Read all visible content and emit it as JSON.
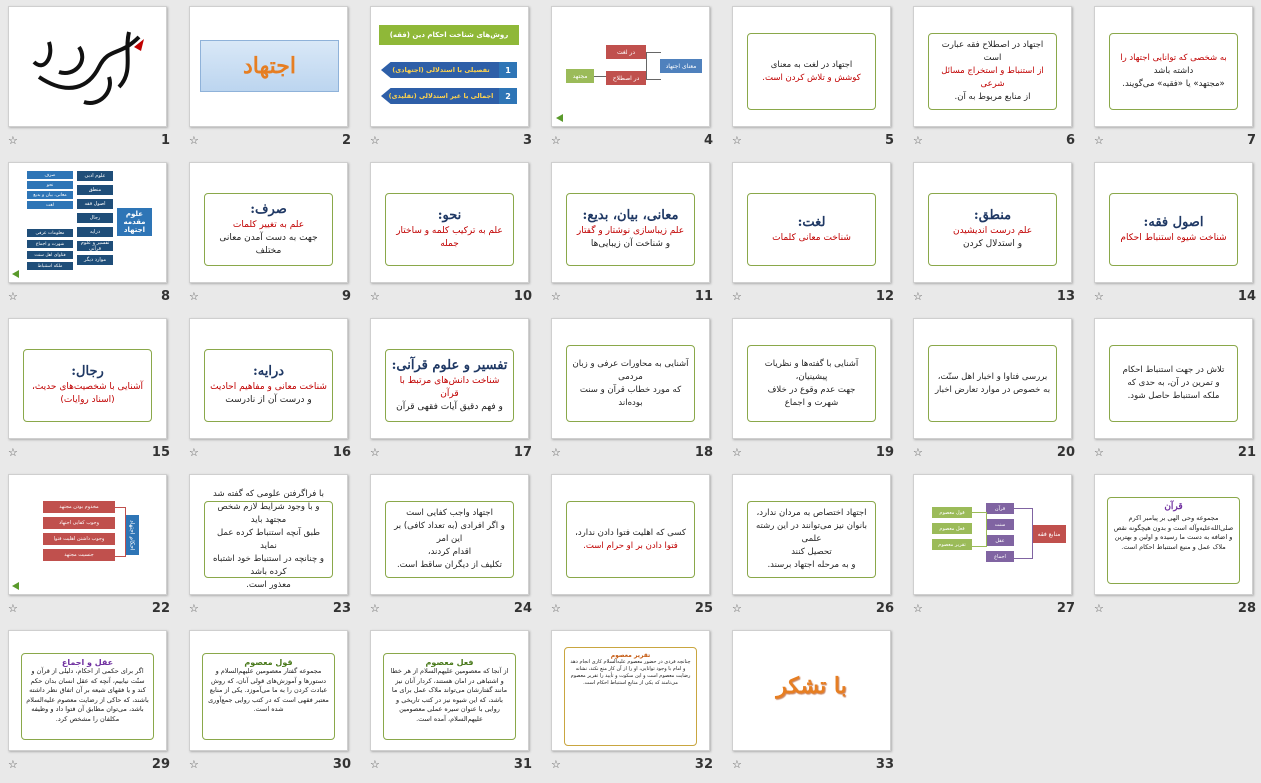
{
  "slides": [
    {
      "n": "1",
      "calligraphy": "بسم الله الرحمن الرحیم"
    },
    {
      "n": "2",
      "title": "اجتهاد"
    },
    {
      "n": "3",
      "header": "روش‌های شناخت احکام دین (فقه)",
      "item1": "تفصیلی با استدلالی (اجتهادی)",
      "item2": "اجمالی یا غیر استدلالی (تقلیدی)",
      "num1": "1",
      "num2": "2"
    },
    {
      "n": "4",
      "left": "معنای اجتهاد",
      "a": "در لغت",
      "b": "در اصطلاح",
      "c": "مجتهد"
    },
    {
      "n": "5",
      "line1": "اجتهاد در لغت به معنای",
      "line2": "کوشش و تلاش کردن است."
    },
    {
      "n": "6",
      "line1": "اجتهاد در اصطلاح فقه عبارت است",
      "line2": "از استنباط و استخراج مسائل شرعی",
      "line3": "از منابع مربوط به آن."
    },
    {
      "n": "7",
      "line1": "به شخصی که توانایی اجتهاد را",
      "line2": "داشته باشد",
      "line3": "«مجتهد» یا «فقیه» می‌گویند."
    },
    {
      "n": "8",
      "root": "علوم مقدمه اجتهاد",
      "items": [
        "علوم ادبی",
        "منطق",
        "اصول فقه",
        "رجال",
        "درایه",
        "تفسیر و علوم قرآنی",
        "موارد دیگر"
      ],
      "sub": [
        "صرف",
        "نحو",
        "معانی، بیان و بدیع",
        "لغت",
        "معلومات عرفی",
        "شهرت و اجماع",
        "فتاوای اهل سنت",
        "ملکه استنباط"
      ]
    },
    {
      "n": "9",
      "title": "صرف:",
      "line1": "علم به تغییر کلمات",
      "line2": "جهت به دست آمدن معانی مختلف"
    },
    {
      "n": "10",
      "title": "نحو:",
      "line1": "علم به ترکیب کلمه و ساختار جمله"
    },
    {
      "n": "11",
      "title": "معانی، بیان، بدیع:",
      "line1": "علم زیباسازی نوشتار و گفتار",
      "line2": "و شناخت آن زیبایی‌ها"
    },
    {
      "n": "12",
      "title": "لغت:",
      "line1": "شناخت معانی کلمات"
    },
    {
      "n": "13",
      "title": "منطق:",
      "line1": "علم درست اندیشیدن",
      "line2": "و استدلال کردن"
    },
    {
      "n": "14",
      "title": "اصول فقه:",
      "line1": "شناخت شیوه استنباط احکام"
    },
    {
      "n": "15",
      "title": "رجال:",
      "line1": "آشنایی با شخصیت‌های حدیث،",
      "line2": "(اسناد روایات)"
    },
    {
      "n": "16",
      "title": "درایه:",
      "line1": "شناخت معانی و مفاهیم احادیث",
      "line2": "و درست آن از نادرست"
    },
    {
      "n": "17",
      "title": "تفسیر و علوم قرآنی:",
      "line1": "شناخت دانش‌های مرتبط با قرآن",
      "line2": "و فهم دقیق آیات فقهی قرآن"
    },
    {
      "n": "18",
      "line1": "آشنایی به محاورات عرفی و زبان مردمی",
      "line2": "که مورد خطاب قرآن و سنت بوده‌اند"
    },
    {
      "n": "19",
      "line1": "آشنایی با گفته‌ها و نظریات پیشینیان،",
      "line2": "جهت عدم وقوع در خلاف",
      "line3": "شهرت و اجماع"
    },
    {
      "n": "20",
      "line1": "بررسی فتاوا و اخبار اهل سنّت،",
      "line2": "به خصوص در موارد تعارض اخبار"
    },
    {
      "n": "21",
      "line1": "تلاش در جهت استنباط احکام",
      "line2": "و تمرین در آن، به حدی که",
      "line3": "ملکه استنباط حاصل شود."
    },
    {
      "n": "22",
      "root": "احکام اجتهاد",
      "items": [
        "مخدوم بودن مجتهد",
        "وجوب کفایی اجتهاد",
        "وجوب داشتن اهلیت فتوا",
        "جنسیت مجتهد"
      ]
    },
    {
      "n": "23",
      "line1": "با فراگرفتن علومی که گفته شد",
      "line2": "و با وجود شرایط لازم شخص مجتهد باید",
      "line3": "طبق آنچه استنباط کرده عمل نماید",
      "line4": "و چنانچه در استنباط خود اشتباه کرده باشد",
      "line5": "معذور است."
    },
    {
      "n": "24",
      "line1": "اجتهاد واجب کفایی است",
      "line2": "و اگر افرادی (به تعداد کافی) بر این امر",
      "line3": "اقدام کردند،",
      "line4": "تکلیف از دیگران ساقط است."
    },
    {
      "n": "25",
      "line1": "کسی که اهلیت فتوا دادن ندارد،",
      "line2": "فتوا دادن بر او حرام است."
    },
    {
      "n": "26",
      "line1": "اجتهاد اختصاص به مردان ندارد،",
      "line2": "بانوان نیز می‌توانند در این رشته علمی",
      "line3": "تحصیل کنند",
      "line4": "و به مرحله اجتهاد برسند."
    },
    {
      "n": "27",
      "root": "منابع فقه",
      "items": [
        "قرآن",
        "سنت",
        "عقل",
        "اجماع"
      ],
      "sub": [
        "قول معصوم",
        "فعل معصوم",
        "تقریر معصوم"
      ]
    },
    {
      "n": "28",
      "title": "قرآن",
      "body": "مجموعه وحی الهی بر پیامبر اکرم صلی‌الله‌علیه‌وآله است و بدون هیچگونه نقص و اضافه به دست ما رسیده و اولین و بهترین ملاک عمل و منبع استنباط احکام است."
    },
    {
      "n": "29",
      "title": "عقل و اجماع",
      "body": "اگر برای حکمی از احکام، دلیلی از قرآن و سنّت نیابیم، آنچه که عقل انسان بدان حکم کند و یا فقهای شیعه بر آن اتفاق نظر داشته باشند، که حاکی از رضایت معصوم علیه‌السلام باشد، می‌توان مطابق آن فتوا داد و وظیفه مکلفان را مشخص کرد."
    },
    {
      "n": "30",
      "title": "قول معصوم",
      "body": "مجموعه گفتار معصومین علیهم‌السلام و دستورها و آموزش‌های قولی آنان، که روش عبادت کردن را به ما می‌آموزد. یکی از منابع معتبر فقهی است که در کتب روایی جمع‌آوری شده است."
    },
    {
      "n": "31",
      "title": "فعل معصوم",
      "body": "از آنجا که معصومین علیهم‌السلام از هر خطا و اشتباهی در امان هستند، کردار آنان نیز مانند گفتارشان می‌تواند ملاک عمل برای ما باشد، که این شیوه نیز در کتب تاریخی و روایی با عنوان سیره عملی معصومین علیهم‌السلام، آمده است."
    },
    {
      "n": "32",
      "title": "تقریر معصوم",
      "body": "چنانچه فردی در حضور معصوم علیه‌السلام کاری انجام دهد و امام با وجود توانایی، او را از آن کار منع نکند، نشانه رضایت معصوم است و این سکوت و تأیید را تقریر معصوم می‌نامند که یکی از منابع استنباط احکام است."
    },
    {
      "n": "33",
      "title": "با تشکر"
    }
  ],
  "colors": {
    "green": "#8aa84a",
    "red": "#c00000",
    "navy": "#1f3864",
    "orange": "#e67e22",
    "blue": "#2e75b6",
    "purple": "#7030a0"
  }
}
